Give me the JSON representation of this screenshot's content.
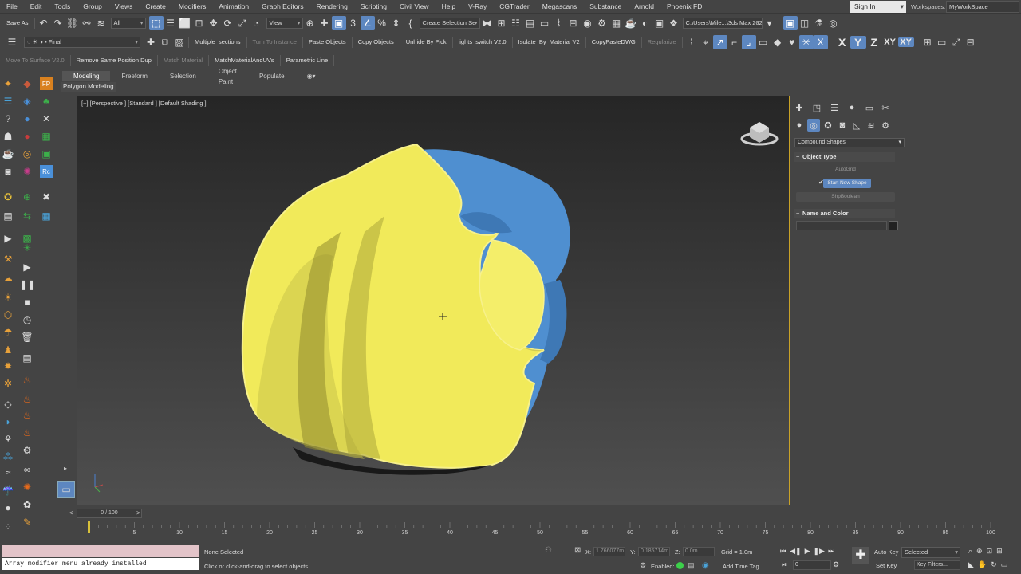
{
  "menu": {
    "items": [
      "File",
      "Edit",
      "Tools",
      "Group",
      "Views",
      "Create",
      "Modifiers",
      "Animation",
      "Graph Editors",
      "Rendering",
      "Scripting",
      "Civil View",
      "Help",
      "V-Ray",
      "CGTrader",
      "Megascans",
      "Substance",
      "Arnold",
      "Phoenix FD"
    ],
    "sign_in": "Sign In",
    "workspaces_label": "Workspaces:",
    "workspace_value": "MyWorkSpace"
  },
  "toolbar1": {
    "save_as": "Save As",
    "filter": "All",
    "ref_coord": "View",
    "named_sel": "Create Selection Se",
    "project_path": "C:\\Users\\Mile...\\3ds Max 2021"
  },
  "toolbar2": {
    "layer": "Final",
    "scripts": [
      {
        "label": "Multiple_sections",
        "dim": false
      },
      {
        "label": "Turn To Instance",
        "dim": true
      },
      {
        "label": "Paste Objects",
        "dim": false
      },
      {
        "label": "Copy Objects",
        "dim": false
      },
      {
        "label": "Unhide By Pick",
        "dim": false
      },
      {
        "label": "lights_switch V2.0",
        "dim": false
      },
      {
        "label": "Isolate_By_Material V2",
        "dim": false
      },
      {
        "label": "CopyPasteDWG",
        "dim": false
      },
      {
        "label": "Regularize",
        "dim": true
      }
    ],
    "axes": [
      "X",
      "Y",
      "Z",
      "XY",
      "XY"
    ]
  },
  "toolbar3": {
    "scripts": [
      {
        "label": "Move To Surface V2.0",
        "dim": true
      },
      {
        "label": "Remove Same Position Dup",
        "dim": false
      },
      {
        "label": "Match Material",
        "dim": true
      },
      {
        "label": "MatchMaterialAndUVs",
        "dim": false
      },
      {
        "label": "Parametric Line",
        "dim": false
      }
    ]
  },
  "ribbon": {
    "tabs": [
      "Modeling",
      "Freeform",
      "Selection",
      "Object Paint",
      "Populate"
    ],
    "active_tab": "Modeling",
    "sub_panel": "Polygon Modeling"
  },
  "viewport": {
    "label": "[+] [Perspective ] [Standard ] [Default Shading ]",
    "selection_color": "#f4ef5a",
    "object_color_secondary": "#4f8fd0"
  },
  "command_panel": {
    "dropdown": "Compound Shapes",
    "object_type_title": "Object Type",
    "autogrid": "AutoGrid",
    "start_new_shape": "Start New Shape",
    "shape_button": "ShpBoolean",
    "name_color_title": "Name and Color"
  },
  "timeline": {
    "slider": "0 / 100",
    "ticks": [
      "0",
      "5",
      "10",
      "15",
      "20",
      "25",
      "30",
      "35",
      "40",
      "45",
      "50",
      "55",
      "60",
      "65",
      "70",
      "75",
      "80",
      "85",
      "90",
      "95",
      "100"
    ]
  },
  "status": {
    "maxscript_output": "Array modifier menu already installed",
    "selection": "None Selected",
    "prompt": "Click or click-and-drag to select objects",
    "x_label": "X:",
    "x_value": "1.766077m",
    "y_label": "Y:",
    "y_value": "0.185714m",
    "z_label": "Z:",
    "z_value": "0.0m",
    "grid": "Grid = 1.0m",
    "enabled": "Enabled:",
    "add_time_tag": "Add Time Tag",
    "auto_key": "Auto Key",
    "set_key": "Set Key",
    "key_mode": "Selected",
    "key_filters": "Key Filters...",
    "frame": "0"
  }
}
